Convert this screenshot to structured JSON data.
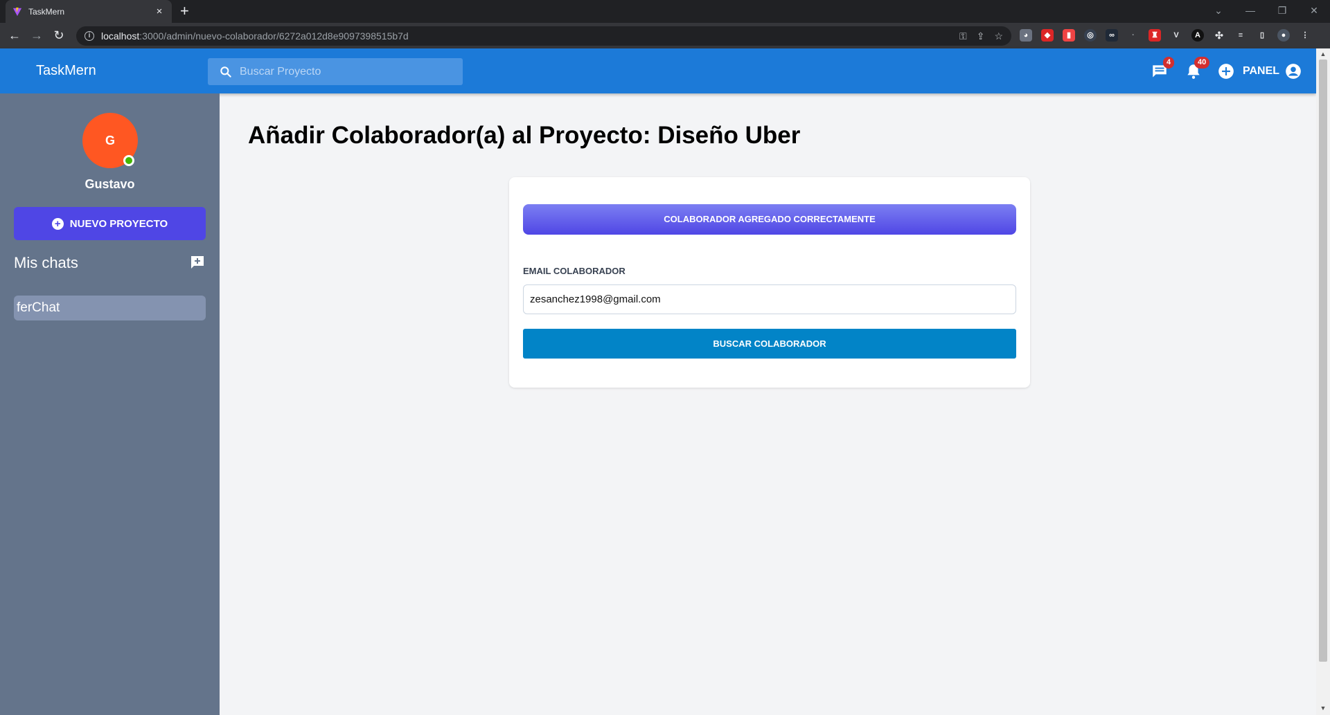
{
  "browser": {
    "tab_title": "TaskMern",
    "tab_close": "×",
    "new_tab": "+",
    "url_host": "localhost",
    "url_path": ":3000/admin/nuevo-colaborador/6272a012d8e9097398515b7d"
  },
  "header": {
    "logo": "TaskMern",
    "search_placeholder": "Buscar Proyecto",
    "chat_badge": "4",
    "notification_badge": "40",
    "panel_label": "PANEL"
  },
  "sidebar": {
    "avatar_initial": "G",
    "username": "Gustavo",
    "new_project_label": "NUEVO PROYECTO",
    "chats_title": "Mis chats",
    "chats": [
      {
        "name": "ferChat"
      }
    ]
  },
  "main": {
    "title": "Añadir Colaborador(a) al Proyecto: Diseño Uber",
    "alert_text": "Colaborador agregado correctamente",
    "email_label": "Email Colaborador",
    "email_value": "zesanchez1998@gmail.com",
    "submit_label": "Buscar Colaborador"
  },
  "colors": {
    "header": "#1c7ad8",
    "sidebar": "#64748b",
    "primary_button": "#4f46e5",
    "submit_button": "#0284c7",
    "avatar": "#ff5722",
    "badge": "#d32f2f"
  }
}
